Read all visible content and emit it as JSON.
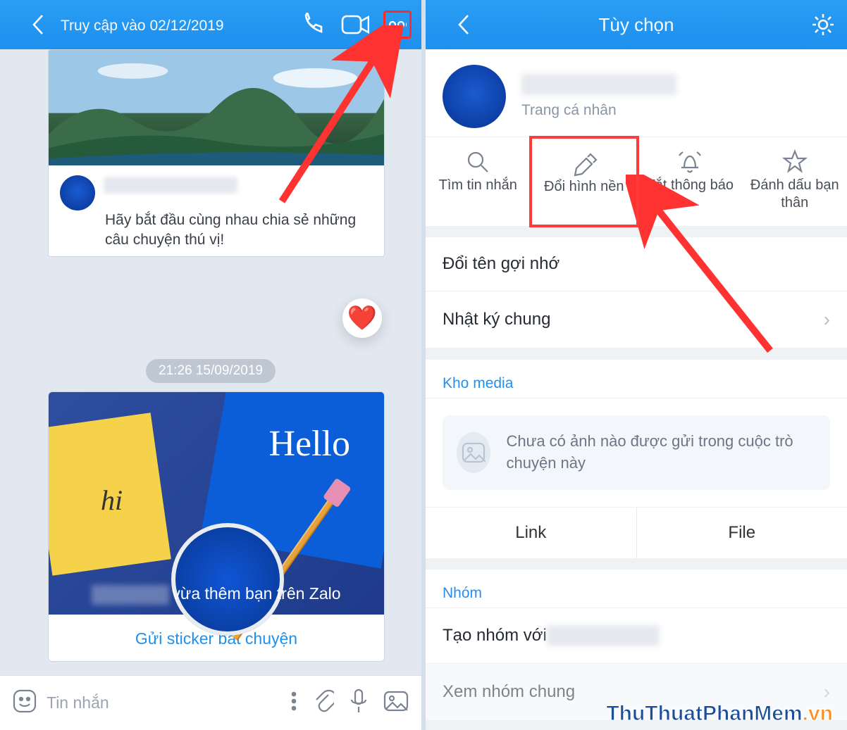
{
  "left_header": {
    "status": "Truy cập vào 02/12/2019"
  },
  "chat": {
    "intro_msg": "Hãy bắt đầu cùng nhau chia sẻ những câu chuyện thú vị!",
    "heart_emoji": "❤️",
    "timestamp": "21:26 15/09/2019",
    "added_text": "vừa thêm bạn trên Zalo",
    "hello_label": "Hello",
    "hi_label": "hi",
    "sticker_action": "Gửi sticker bắt chuyện"
  },
  "composer": {
    "placeholder": "Tin nhắn"
  },
  "right_header": {
    "title": "Tùy chọn"
  },
  "profile": {
    "subtitle": "Trang cá nhân"
  },
  "quick_actions": [
    {
      "label": "Tìm tin nhắn"
    },
    {
      "label": "Đổi hình nền"
    },
    {
      "label": "Tắt thông báo"
    },
    {
      "label": "Đánh dấu bạn thân"
    }
  ],
  "options": {
    "rename": "Đổi tên gợi nhớ",
    "diary": "Nhật ký chung",
    "media_section": "Kho media",
    "media_empty": "Chưa có ảnh nào được gửi trong cuộc trò chuyện này",
    "tab_link": "Link",
    "tab_file": "File",
    "group_section": "Nhóm",
    "create_group": "Tạo nhóm với ",
    "common_groups": "Xem nhóm chung"
  },
  "watermark": {
    "a": "ThuThuatPhanMem",
    ".": "vn"
  }
}
